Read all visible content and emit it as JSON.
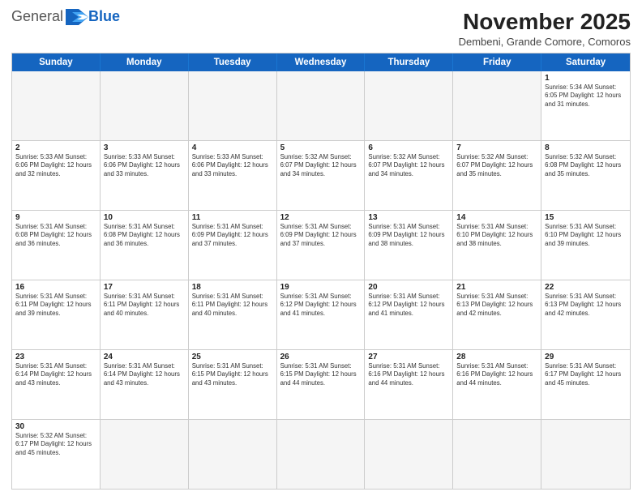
{
  "header": {
    "logo_general": "General",
    "logo_blue": "Blue",
    "month_title": "November 2025",
    "location": "Dembeni, Grande Comore, Comoros"
  },
  "days_of_week": [
    "Sunday",
    "Monday",
    "Tuesday",
    "Wednesday",
    "Thursday",
    "Friday",
    "Saturday"
  ],
  "weeks": [
    [
      {
        "day": "",
        "info": ""
      },
      {
        "day": "",
        "info": ""
      },
      {
        "day": "",
        "info": ""
      },
      {
        "day": "",
        "info": ""
      },
      {
        "day": "",
        "info": ""
      },
      {
        "day": "",
        "info": ""
      },
      {
        "day": "1",
        "info": "Sunrise: 5:34 AM\nSunset: 6:05 PM\nDaylight: 12 hours and 31 minutes."
      }
    ],
    [
      {
        "day": "2",
        "info": "Sunrise: 5:33 AM\nSunset: 6:06 PM\nDaylight: 12 hours and 32 minutes."
      },
      {
        "day": "3",
        "info": "Sunrise: 5:33 AM\nSunset: 6:06 PM\nDaylight: 12 hours and 33 minutes."
      },
      {
        "day": "4",
        "info": "Sunrise: 5:33 AM\nSunset: 6:06 PM\nDaylight: 12 hours and 33 minutes."
      },
      {
        "day": "5",
        "info": "Sunrise: 5:32 AM\nSunset: 6:07 PM\nDaylight: 12 hours and 34 minutes."
      },
      {
        "day": "6",
        "info": "Sunrise: 5:32 AM\nSunset: 6:07 PM\nDaylight: 12 hours and 34 minutes."
      },
      {
        "day": "7",
        "info": "Sunrise: 5:32 AM\nSunset: 6:07 PM\nDaylight: 12 hours and 35 minutes."
      },
      {
        "day": "8",
        "info": "Sunrise: 5:32 AM\nSunset: 6:08 PM\nDaylight: 12 hours and 35 minutes."
      }
    ],
    [
      {
        "day": "9",
        "info": "Sunrise: 5:31 AM\nSunset: 6:08 PM\nDaylight: 12 hours and 36 minutes."
      },
      {
        "day": "10",
        "info": "Sunrise: 5:31 AM\nSunset: 6:08 PM\nDaylight: 12 hours and 36 minutes."
      },
      {
        "day": "11",
        "info": "Sunrise: 5:31 AM\nSunset: 6:09 PM\nDaylight: 12 hours and 37 minutes."
      },
      {
        "day": "12",
        "info": "Sunrise: 5:31 AM\nSunset: 6:09 PM\nDaylight: 12 hours and 37 minutes."
      },
      {
        "day": "13",
        "info": "Sunrise: 5:31 AM\nSunset: 6:09 PM\nDaylight: 12 hours and 38 minutes."
      },
      {
        "day": "14",
        "info": "Sunrise: 5:31 AM\nSunset: 6:10 PM\nDaylight: 12 hours and 38 minutes."
      },
      {
        "day": "15",
        "info": "Sunrise: 5:31 AM\nSunset: 6:10 PM\nDaylight: 12 hours and 39 minutes."
      }
    ],
    [
      {
        "day": "16",
        "info": "Sunrise: 5:31 AM\nSunset: 6:11 PM\nDaylight: 12 hours and 39 minutes."
      },
      {
        "day": "17",
        "info": "Sunrise: 5:31 AM\nSunset: 6:11 PM\nDaylight: 12 hours and 40 minutes."
      },
      {
        "day": "18",
        "info": "Sunrise: 5:31 AM\nSunset: 6:11 PM\nDaylight: 12 hours and 40 minutes."
      },
      {
        "day": "19",
        "info": "Sunrise: 5:31 AM\nSunset: 6:12 PM\nDaylight: 12 hours and 41 minutes."
      },
      {
        "day": "20",
        "info": "Sunrise: 5:31 AM\nSunset: 6:12 PM\nDaylight: 12 hours and 41 minutes."
      },
      {
        "day": "21",
        "info": "Sunrise: 5:31 AM\nSunset: 6:13 PM\nDaylight: 12 hours and 42 minutes."
      },
      {
        "day": "22",
        "info": "Sunrise: 5:31 AM\nSunset: 6:13 PM\nDaylight: 12 hours and 42 minutes."
      }
    ],
    [
      {
        "day": "23",
        "info": "Sunrise: 5:31 AM\nSunset: 6:14 PM\nDaylight: 12 hours and 43 minutes."
      },
      {
        "day": "24",
        "info": "Sunrise: 5:31 AM\nSunset: 6:14 PM\nDaylight: 12 hours and 43 minutes."
      },
      {
        "day": "25",
        "info": "Sunrise: 5:31 AM\nSunset: 6:15 PM\nDaylight: 12 hours and 43 minutes."
      },
      {
        "day": "26",
        "info": "Sunrise: 5:31 AM\nSunset: 6:15 PM\nDaylight: 12 hours and 44 minutes."
      },
      {
        "day": "27",
        "info": "Sunrise: 5:31 AM\nSunset: 6:16 PM\nDaylight: 12 hours and 44 minutes."
      },
      {
        "day": "28",
        "info": "Sunrise: 5:31 AM\nSunset: 6:16 PM\nDaylight: 12 hours and 44 minutes."
      },
      {
        "day": "29",
        "info": "Sunrise: 5:31 AM\nSunset: 6:17 PM\nDaylight: 12 hours and 45 minutes."
      }
    ],
    [
      {
        "day": "30",
        "info": "Sunrise: 5:32 AM\nSunset: 6:17 PM\nDaylight: 12 hours and 45 minutes."
      },
      {
        "day": "",
        "info": ""
      },
      {
        "day": "",
        "info": ""
      },
      {
        "day": "",
        "info": ""
      },
      {
        "day": "",
        "info": ""
      },
      {
        "day": "",
        "info": ""
      },
      {
        "day": "",
        "info": ""
      }
    ]
  ]
}
